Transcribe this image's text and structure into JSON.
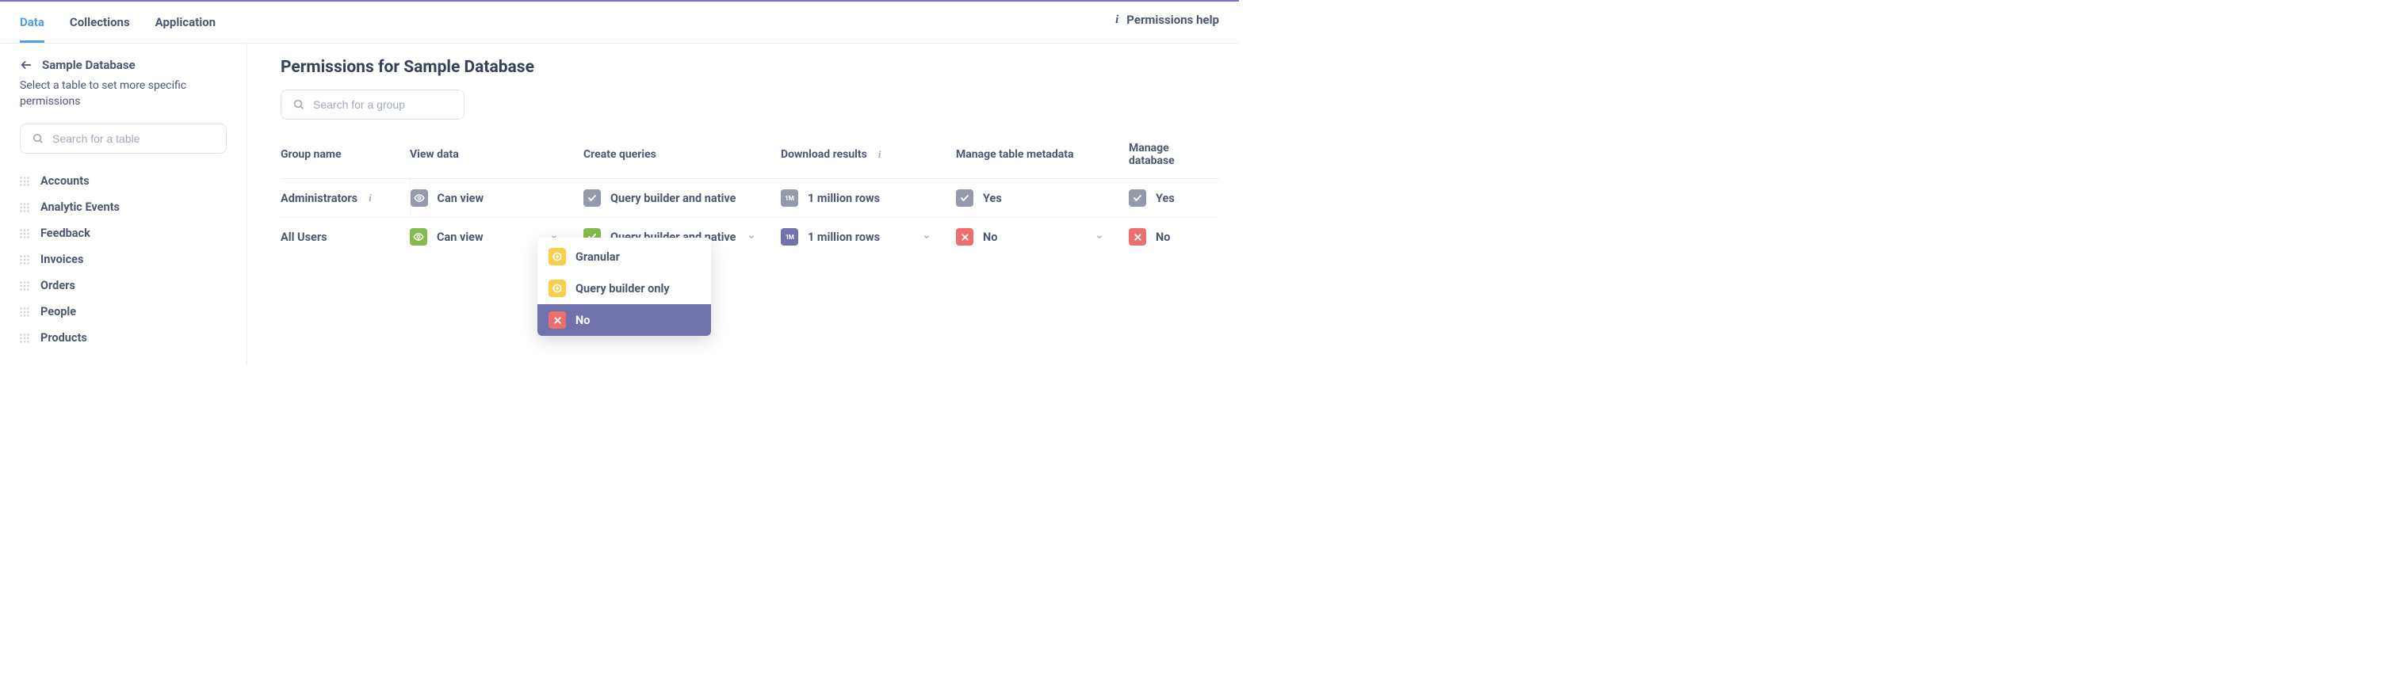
{
  "header": {
    "tabs": [
      {
        "label": "Data",
        "active": true
      },
      {
        "label": "Collections",
        "active": false
      },
      {
        "label": "Application",
        "active": false
      }
    ],
    "help_label": "Permissions help"
  },
  "sidebar": {
    "back_label": "Sample Database",
    "subtitle": "Select a table to set more specific permissions",
    "search_placeholder": "Search for a table",
    "tables": [
      {
        "label": "Accounts"
      },
      {
        "label": "Analytic Events"
      },
      {
        "label": "Feedback"
      },
      {
        "label": "Invoices"
      },
      {
        "label": "Orders"
      },
      {
        "label": "People"
      },
      {
        "label": "Products"
      }
    ]
  },
  "main": {
    "title": "Permissions for Sample Database",
    "search_placeholder": "Search for a group",
    "columns": {
      "group": "Group name",
      "view": "View data",
      "create": "Create queries",
      "download": "Download results",
      "metadata": "Manage table metadata",
      "database": "Manage database"
    },
    "rows": [
      {
        "name": "Administrators",
        "name_info": true,
        "editable": false,
        "view": {
          "label": "Can view",
          "icon": "eye",
          "color": "gray"
        },
        "create": {
          "label": "Query builder and native",
          "icon": "check",
          "color": "gray"
        },
        "download": {
          "label": "1 million rows",
          "icon": "1m",
          "color": "gray"
        },
        "metadata": {
          "label": "Yes",
          "icon": "check",
          "color": "gray"
        },
        "database": {
          "label": "Yes",
          "icon": "check",
          "color": "gray"
        }
      },
      {
        "name": "All Users",
        "name_info": false,
        "editable": true,
        "view": {
          "label": "Can view",
          "icon": "eye",
          "color": "green"
        },
        "create": {
          "label": "Query builder and native",
          "icon": "check",
          "color": "green"
        },
        "download": {
          "label": "1 million rows",
          "icon": "1m",
          "color": "purple"
        },
        "metadata": {
          "label": "No",
          "icon": "x",
          "color": "red"
        },
        "database": {
          "label": "No",
          "icon": "x",
          "color": "red"
        }
      }
    ],
    "dropdown": {
      "options": [
        {
          "label": "Granular",
          "icon": "target",
          "color": "yellow",
          "highlight": false
        },
        {
          "label": "Query builder only",
          "icon": "target",
          "color": "yellow",
          "highlight": false
        },
        {
          "label": "No",
          "icon": "x",
          "color": "red",
          "highlight": true
        }
      ]
    }
  }
}
